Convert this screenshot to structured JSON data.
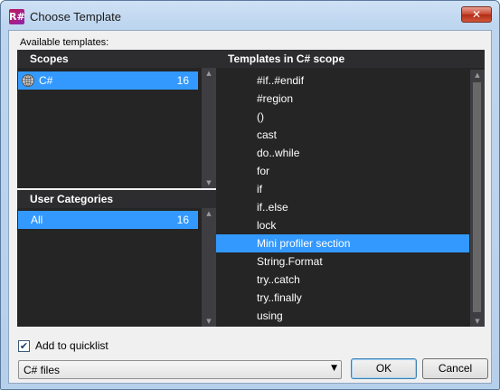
{
  "window": {
    "title": "Choose Template",
    "app_icon_glyph": "R#",
    "close_glyph": "✕"
  },
  "available_label": "Available templates:",
  "scopes": {
    "header": "Scopes",
    "items": [
      {
        "label": "C#",
        "count": "16",
        "icon": "csharp-globe-icon",
        "selected": true
      }
    ]
  },
  "categories": {
    "header": "User Categories",
    "items": [
      {
        "label": "All",
        "count": "16",
        "selected": true
      }
    ]
  },
  "templates": {
    "header": "Templates in C# scope",
    "items": [
      "#if..#endif",
      "#region",
      "()",
      "cast",
      "do..while",
      "for",
      "if",
      "if..else",
      "lock",
      "Mini profiler section",
      "String.Format",
      "try..catch",
      "try..finally",
      "using"
    ],
    "selected_index": 9
  },
  "quicklist": {
    "label": "Add to quicklist",
    "checked": true,
    "check_glyph": "✔"
  },
  "file_combo": {
    "value": "C# files",
    "arrow_glyph": "▼"
  },
  "buttons": {
    "ok": "OK",
    "cancel": "Cancel"
  },
  "scroll_glyphs": {
    "up": "▲",
    "down": "▼"
  },
  "colors": {
    "selection": "#3399ff",
    "panel_bg": "#252526",
    "panel_header_bg": "#2d2d30"
  }
}
